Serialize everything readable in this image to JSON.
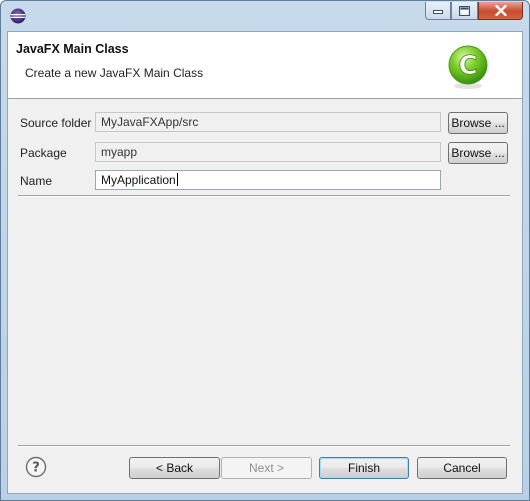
{
  "banner": {
    "title": "JavaFX Main Class",
    "subtitle": "Create a new JavaFX Main Class",
    "icon": "javafx-class-icon",
    "icon_letter": "C"
  },
  "form": {
    "source_folder": {
      "label": "Source folder",
      "value": "MyJavaFXApp/src",
      "browse_label": "Browse ..."
    },
    "package": {
      "label": "Package",
      "value": "myapp",
      "browse_label": "Browse ..."
    },
    "name": {
      "label": "Name",
      "value": "MyApplication"
    }
  },
  "footer": {
    "back_label": "< Back",
    "next_label": "Next >",
    "finish_label": "Finish",
    "cancel_label": "Cancel"
  },
  "colors": {
    "accent": "#3c7fb1",
    "icon_green": "#5cbf1f"
  }
}
